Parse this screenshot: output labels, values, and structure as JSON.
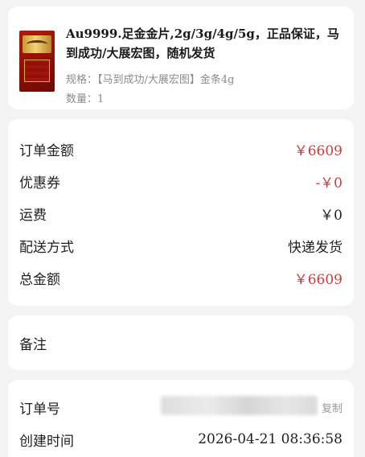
{
  "product": {
    "title": "Au9999.足金金片,2g/3g/4g/5g，正品保证，马到成功/大展宏图，随机发货",
    "spec_label": "规格：",
    "spec_value": "【马到成功/大展宏图】金条4g",
    "qty_label": "数量：",
    "qty_value": "1"
  },
  "summary": {
    "order_amount_label": "订单金额",
    "order_amount_value": "￥6609",
    "coupon_label": "优惠券",
    "coupon_value": "-￥0",
    "shipping_label": "运费",
    "shipping_value": "￥0",
    "delivery_label": "配送方式",
    "delivery_value": "快递发货",
    "total_label": "总金额",
    "total_value": "￥6609"
  },
  "remark": {
    "label": "备注"
  },
  "order": {
    "number_label": "订单号",
    "copy_label": "复制",
    "created_label": "创建时间",
    "created_value": "2026-04-21 08:36:58"
  },
  "colors": {
    "accent_red": "#d23a3a",
    "background": "#f3f3f3"
  }
}
